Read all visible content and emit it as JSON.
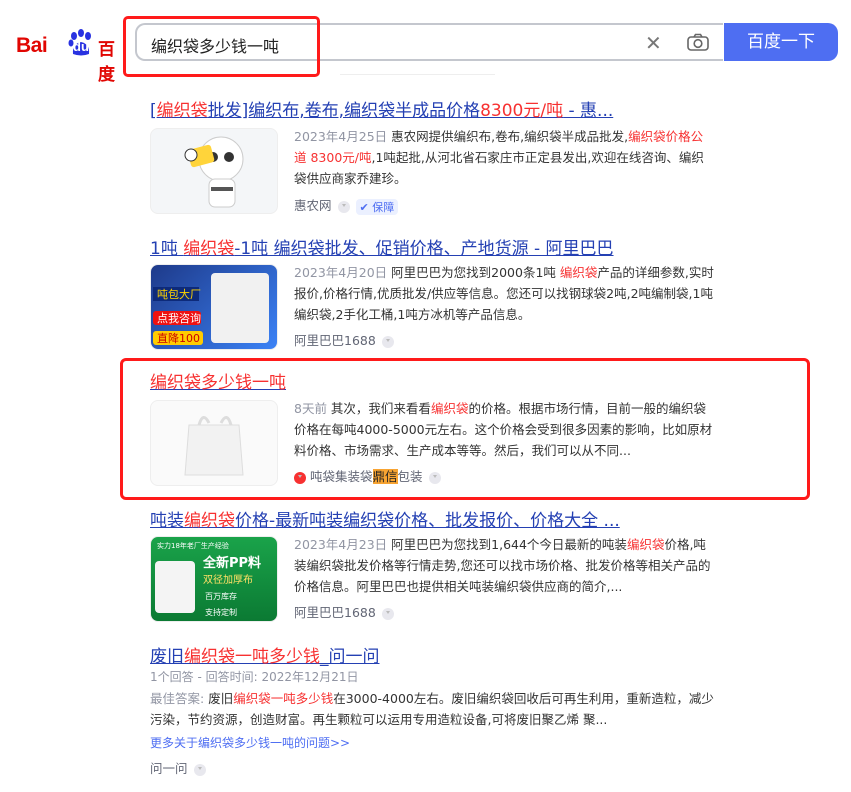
{
  "logo": {
    "text_left": "Bai",
    "text_paw": "du",
    "text_right": "百度"
  },
  "search": {
    "query": "编织袋多少钱一吨",
    "clear_icon": "close-icon",
    "camera_icon": "camera-icon",
    "button": "百度一下"
  },
  "results": [
    {
      "title_parts": [
        "[",
        "编织袋",
        "批发]编织布,卷布,编织袋半成品价格",
        "8300元/吨",
        " - 惠..."
      ],
      "date": "2023年4月25日",
      "abstract_parts": [
        " 惠农网提供编织布,卷布,编织袋半成品批发,",
        "编织袋价格公道 8300元/吨",
        ",1吨起批,从河北省石家庄市正定县发出,欢迎在线咨询、编织袋供应商家乔建珍。"
      ],
      "source": "惠农网",
      "badge": "保障"
    },
    {
      "title_parts": [
        "1吨 ",
        "编织袋",
        "-1吨 编织袋批发、促销价格、产地货源 - 阿里巴巴"
      ],
      "date": "2023年4月20日",
      "abstract_parts": [
        " 阿里巴巴为您找到2000条1吨 ",
        "编织袋",
        "产品的详细参数,实时报价,价格行情,优质批发/供应等信息。您还可以找钢球袋2吨,2吨编制袋,1吨编织袋,2手化工桶,1吨方冰机等产品信息。"
      ],
      "source": "阿里巴巴1688",
      "thumb_labels": [
        "吨包大厂",
        "点我咨询",
        "直降100"
      ]
    },
    {
      "title_parts": [
        "编织袋多少钱一吨"
      ],
      "date": "8天前",
      "abstract_parts": [
        " 其次，我们来看看",
        "编织袋",
        "的价格。根据市场行情，目前一般的编织袋价格在每吨4000-5000元左右。这个价格会受到很多因素的影响，比如原材料价格、市场需求、生产成本等等。然后，我们可以从不同..."
      ],
      "source_parts": [
        "吨袋集装袋",
        "鼎信",
        "包装"
      ]
    },
    {
      "title_parts": [
        "吨装",
        "编织袋",
        "价格-最新吨装编织袋价格、批发报价、价格大全 ..."
      ],
      "date": "2023年4月23日",
      "abstract_parts": [
        " 阿里巴巴为您找到1,644个今日最新的吨装",
        "编织袋",
        "价格,吨装编织袋批发价格等行情走势,您还可以找市场价格、批发价格等相关产品的价格信息。阿里巴巴也提供相关吨装编织袋供应商的简介,..."
      ],
      "source": "阿里巴巴1688",
      "thumb_labels": [
        "实力18年老厂生产经验",
        "全新PP料",
        "双径加厚布",
        "百万库存",
        "支持定制"
      ]
    },
    {
      "title_parts": [
        "废旧",
        "编织袋一吨多少钱",
        "_问一问"
      ],
      "meta": "1个回答 - 回答时间: 2022年12月21日",
      "answer_label": "最佳答案: ",
      "abstract_parts": [
        "废旧",
        "编织袋一吨多少钱",
        "在3000-4000左右。废旧编织袋回收后可再生利用，重新造粒，减少污染，节约资源，创造财富。再生颗粒可以运用专用造粒设备,可将废旧聚乙烯 聚..."
      ],
      "more_link": "更多关于编织袋多少钱一吨的问题>>",
      "source": "问一问"
    }
  ],
  "colors": {
    "title": "#2440b3",
    "highlight": "#f73131",
    "button": "#4e6ef2",
    "annotation": "#ff1a1a"
  }
}
